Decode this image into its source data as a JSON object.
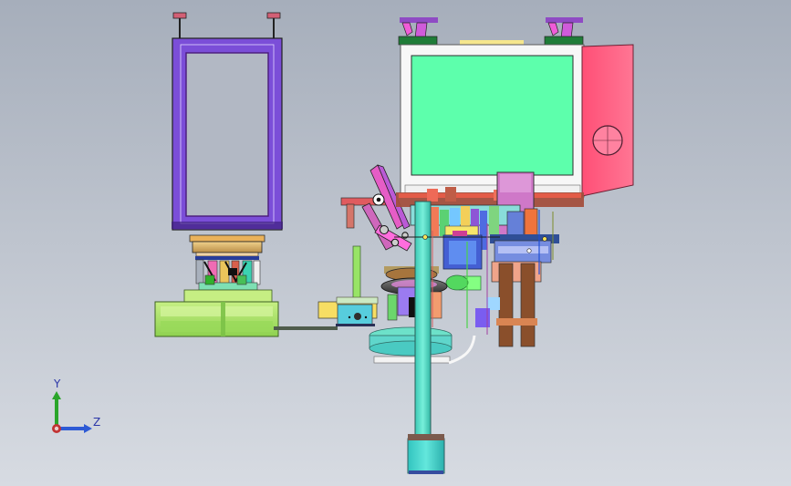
{
  "viewport": {
    "background_top": "#a7afbc",
    "background_bottom": "#d7dbe2"
  },
  "colors": {
    "frame_purple": "#7a4ed8",
    "cabinet_green": "#60ffa8",
    "cabinet_outline": "#f4f4f4",
    "panel_pink": "#ff6a86",
    "base_green": "#a7e06a",
    "column_teal": "#58e0c8",
    "column_block": "#48d7cf",
    "accent_magenta": "#d06cff",
    "accent_yellow": "#f7d95a",
    "accent_orange": "#d8864a",
    "accent_blue": "#4b72d6",
    "accent_red": "#df4b5a",
    "line_dark": "#1c1c1c"
  },
  "axis_triad": {
    "y_label": "Y",
    "z_label": "Z",
    "y_color": "#2aa52a",
    "z_color": "#2d5ad5",
    "origin_color": "#c23333"
  }
}
